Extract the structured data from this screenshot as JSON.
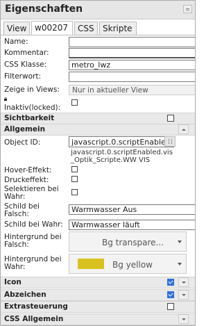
{
  "panel": {
    "title": "Eigenschaften"
  },
  "tabs": [
    {
      "label": "View"
    },
    {
      "label": "w00207"
    },
    {
      "label": "CSS"
    },
    {
      "label": "Skripte"
    }
  ],
  "fields": {
    "name": {
      "label": "Name:",
      "value": ""
    },
    "comment": {
      "label": "Kommentar:",
      "value": ""
    },
    "css_class": {
      "label": "CSS Klasse:",
      "value": "metro_lwz"
    },
    "filter": {
      "label": "Filterwort:",
      "value": ""
    },
    "show_in_views": {
      "label": "Zeige in Views:",
      "value": "Nur in aktueller View"
    },
    "locked": {
      "label": "Inaktiv(locked):",
      "checked": false
    }
  },
  "groups": {
    "visibility": {
      "label": "Sichtbarkeit",
      "checked": false
    },
    "general": {
      "label": "Allgemein"
    },
    "icon": {
      "label": "Icon",
      "checked": true
    },
    "badge": {
      "label": "Abzeichen",
      "checked": true
    },
    "extra": {
      "label": "Extrasteuerung",
      "checked": false
    },
    "css_general": {
      "label": "CSS Allgemein",
      "checked": false
    }
  },
  "general": {
    "object_id": {
      "label": "Object ID:",
      "value": "javascript.0.scriptEnabled",
      "description_line1": "javascript.0.scriptEnabled.vis",
      "description_line2": "_Optik_Scripte.WW VIS"
    },
    "hover": {
      "label": "Hover-Effekt:",
      "checked": false
    },
    "press": {
      "label": "Druckeffekt:",
      "checked": false
    },
    "select_if_true": {
      "label_line1": "Selektieren bei",
      "label_line2": "Wahr:",
      "checked": false
    },
    "sign_false": {
      "label_line1": "Schild bei",
      "label_line2": "Falsch:",
      "value": "Warmwasser Aus"
    },
    "sign_true": {
      "label": "Schild bei Wahr:",
      "value": "Warmwasser läuft"
    },
    "bg_false": {
      "label_line1": "Hintergrund bei",
      "label_line2": "Falsch:",
      "value": "Bg transpare..."
    },
    "bg_true": {
      "label_line1": "Hintergrund bei",
      "label_line2": "Wahr:",
      "value": "Bg yellow",
      "swatch_color": "#d9c21f"
    }
  },
  "colors": {
    "accent": "#2f6fd8",
    "swatch_yellow": "#d9c21f"
  }
}
